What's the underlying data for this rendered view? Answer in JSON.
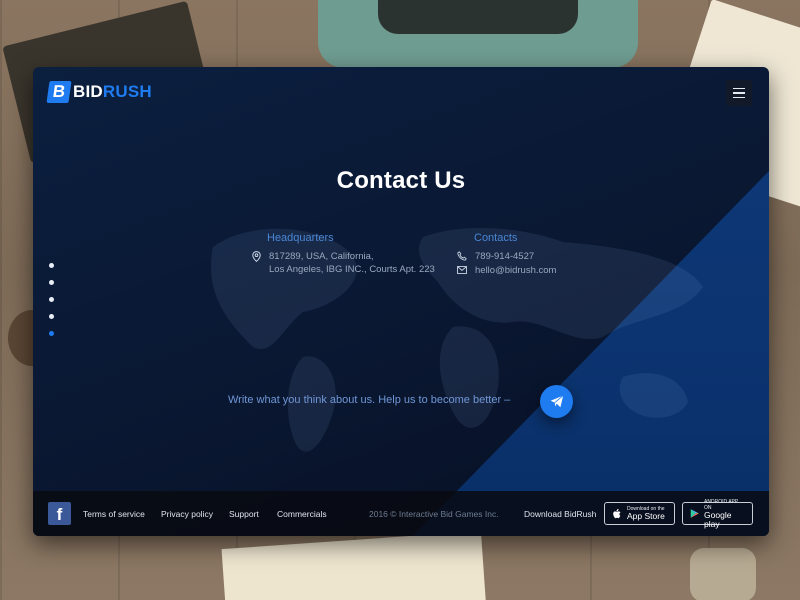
{
  "brand": {
    "logo_mark": "B",
    "name_white": "BID",
    "name_blue": "RUSH",
    "accent": "#1f7cf0"
  },
  "menu": {
    "icon": "hamburger-icon"
  },
  "page": {
    "title": "Contact Us"
  },
  "slide_nav": {
    "count": 5,
    "active_index": 4
  },
  "headquarters": {
    "heading": "Headquarters",
    "line1": "817289, USA, California,",
    "line2": "Los Angeles, IBG INC., Courts Apt. 223",
    "icon": "map-pin-icon"
  },
  "contacts": {
    "heading": "Contacts",
    "phone": "789-914-4527",
    "email": "hello@bidrush.com",
    "phone_icon": "phone-icon",
    "email_icon": "envelope-icon"
  },
  "cta": {
    "text": "Write what you think about us. Help us to become better –",
    "icon": "paper-plane-icon"
  },
  "footer": {
    "facebook": "f",
    "links": [
      "Terms of service",
      "Privacy policy",
      "Support",
      "Commercials"
    ],
    "copyright": "2016 © Interactive Bid Games Inc.",
    "download_label": "Download BidRush",
    "app_store": {
      "small": "Download on the",
      "big": "App Store"
    },
    "google_play": {
      "small": "ANDROID APP ON",
      "big": "Google play"
    }
  }
}
